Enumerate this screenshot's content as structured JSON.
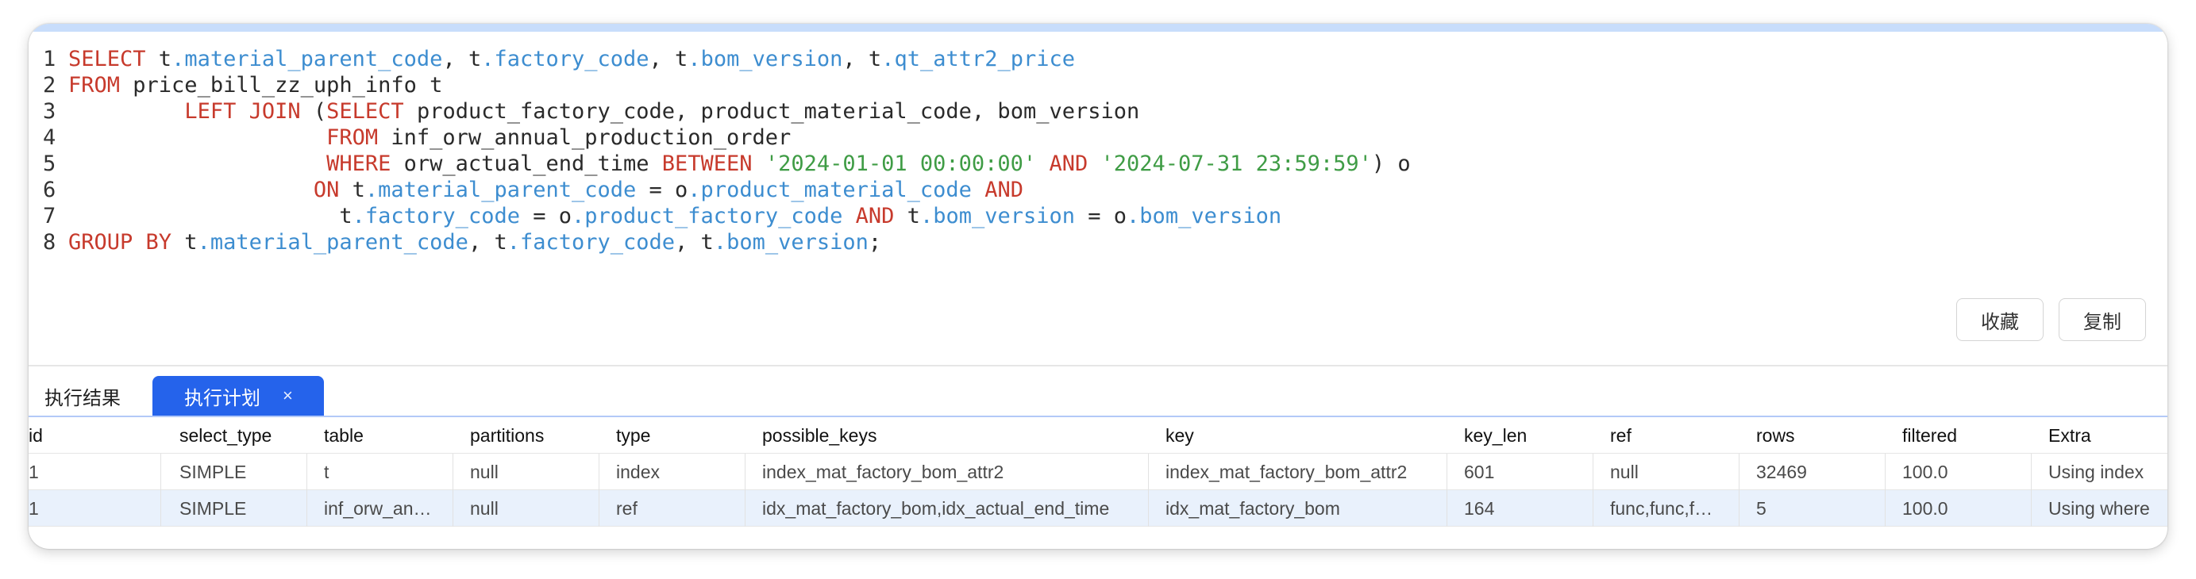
{
  "editor": {
    "lines": [
      {
        "n": "1",
        "indent": "",
        "tokens": [
          {
            "t": "SELECT",
            "c": "kw"
          },
          {
            "t": " t",
            "c": ""
          },
          {
            "t": ".material_parent_code",
            "c": "fld"
          },
          {
            "t": ", t",
            "c": ""
          },
          {
            "t": ".factory_code",
            "c": "fld"
          },
          {
            "t": ", t",
            "c": ""
          },
          {
            "t": ".bom_version",
            "c": "fld"
          },
          {
            "t": ", t",
            "c": ""
          },
          {
            "t": ".qt_attr2_price",
            "c": "fld"
          }
        ]
      },
      {
        "n": "2",
        "indent": "",
        "tokens": [
          {
            "t": "FROM",
            "c": "kw"
          },
          {
            "t": " price_bill_zz_uph_info t",
            "c": ""
          }
        ]
      },
      {
        "n": "3",
        "indent": "         ",
        "tokens": [
          {
            "t": "LEFT JOIN",
            "c": "kw"
          },
          {
            "t": " (",
            "c": ""
          },
          {
            "t": "SELECT",
            "c": "kw"
          },
          {
            "t": " product_factory_code, product_material_code, bom_version",
            "c": ""
          }
        ]
      },
      {
        "n": "4",
        "indent": "                    ",
        "tokens": [
          {
            "t": "FROM",
            "c": "kw"
          },
          {
            "t": " inf_orw_annual_production_order",
            "c": ""
          }
        ]
      },
      {
        "n": "5",
        "indent": "                    ",
        "tokens": [
          {
            "t": "WHERE",
            "c": "kw"
          },
          {
            "t": " orw_actual_end_time ",
            "c": ""
          },
          {
            "t": "BETWEEN",
            "c": "kw"
          },
          {
            "t": " ",
            "c": ""
          },
          {
            "t": "'2024-01-01 00:00:00'",
            "c": "str"
          },
          {
            "t": " ",
            "c": ""
          },
          {
            "t": "AND",
            "c": "kw"
          },
          {
            "t": " ",
            "c": ""
          },
          {
            "t": "'2024-07-31 23:59:59'",
            "c": "str"
          },
          {
            "t": ") o",
            "c": ""
          }
        ]
      },
      {
        "n": "6",
        "indent": "                   ",
        "tokens": [
          {
            "t": "ON",
            "c": "kw"
          },
          {
            "t": " t",
            "c": ""
          },
          {
            "t": ".material_parent_code",
            "c": "fld"
          },
          {
            "t": " = o",
            "c": ""
          },
          {
            "t": ".product_material_code",
            "c": "fld"
          },
          {
            "t": " ",
            "c": ""
          },
          {
            "t": "AND",
            "c": "kw"
          }
        ]
      },
      {
        "n": "7",
        "indent": "                     ",
        "tokens": [
          {
            "t": "t",
            "c": ""
          },
          {
            "t": ".factory_code",
            "c": "fld"
          },
          {
            "t": " = o",
            "c": ""
          },
          {
            "t": ".product_factory_code",
            "c": "fld"
          },
          {
            "t": " ",
            "c": ""
          },
          {
            "t": "AND",
            "c": "kw"
          },
          {
            "t": " t",
            "c": ""
          },
          {
            "t": ".bom_version",
            "c": "fld"
          },
          {
            "t": " = o",
            "c": ""
          },
          {
            "t": ".bom_version",
            "c": "fld"
          }
        ]
      },
      {
        "n": "8",
        "indent": "",
        "tokens": [
          {
            "t": "GROUP BY",
            "c": "kw"
          },
          {
            "t": " t",
            "c": ""
          },
          {
            "t": ".material_parent_code",
            "c": "fld"
          },
          {
            "t": ", t",
            "c": ""
          },
          {
            "t": ".factory_code",
            "c": "fld"
          },
          {
            "t": ", t",
            "c": ""
          },
          {
            "t": ".bom_version",
            "c": "fld"
          },
          {
            "t": ";",
            "c": ""
          }
        ]
      }
    ]
  },
  "actions": {
    "favorite_label": "收藏",
    "copy_label": "复制"
  },
  "tabs": {
    "result_label": "执行结果",
    "plan_label": "执行计划",
    "close_glyph": "×"
  },
  "plan_table": {
    "columns": [
      "id",
      "select_type",
      "table",
      "partitions",
      "type",
      "possible_keys",
      "key",
      "key_len",
      "ref",
      "rows",
      "filtered",
      "Extra"
    ],
    "rows": [
      [
        "1",
        "SIMPLE",
        "t",
        "null",
        "index",
        "index_mat_factory_bom_attr2",
        "index_mat_factory_bom_attr2",
        "601",
        "null",
        "32469",
        "100.0",
        "Using index"
      ],
      [
        "1",
        "SIMPLE",
        "inf_orw_an…",
        "null",
        "ref",
        "idx_mat_factory_bom,idx_actual_end_time",
        "idx_mat_factory_bom",
        "164",
        "func,func,f…",
        "5",
        "100.0",
        "Using where"
      ]
    ]
  }
}
